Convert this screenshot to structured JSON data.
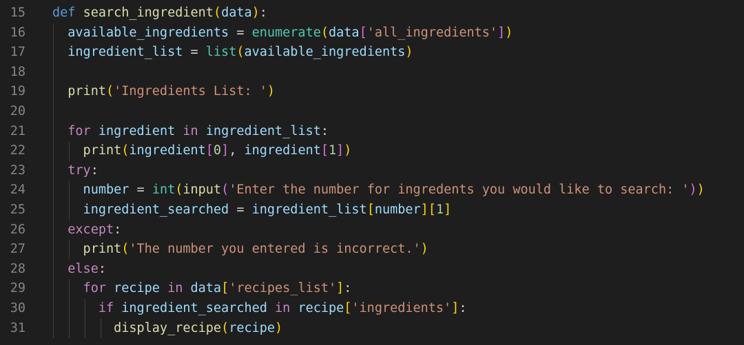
{
  "editor": {
    "lines": [
      {
        "number": "15",
        "indent_guides": 0,
        "tokens": [
          {
            "text": "def",
            "type": "keyword"
          },
          {
            "text": " ",
            "type": "plain"
          },
          {
            "text": "search_ingredient",
            "type": "function"
          },
          {
            "text": "(",
            "type": "bracket1"
          },
          {
            "text": "data",
            "type": "variable"
          },
          {
            "text": ")",
            "type": "bracket1"
          },
          {
            "text": ":",
            "type": "punct"
          }
        ]
      },
      {
        "number": "16",
        "indent_guides": 1,
        "tokens": [
          {
            "text": "  available_ingredients",
            "type": "variable"
          },
          {
            "text": " = ",
            "type": "operator"
          },
          {
            "text": "enumerate",
            "type": "builtin"
          },
          {
            "text": "(",
            "type": "bracket1"
          },
          {
            "text": "data",
            "type": "variable"
          },
          {
            "text": "[",
            "type": "bracket2"
          },
          {
            "text": "'all_ingredients'",
            "type": "string"
          },
          {
            "text": "]",
            "type": "bracket2"
          },
          {
            "text": ")",
            "type": "bracket1"
          }
        ]
      },
      {
        "number": "17",
        "indent_guides": 1,
        "tokens": [
          {
            "text": "  ingredient_list",
            "type": "variable"
          },
          {
            "text": " = ",
            "type": "operator"
          },
          {
            "text": "list",
            "type": "builtin"
          },
          {
            "text": "(",
            "type": "bracket1"
          },
          {
            "text": "available_ingredients",
            "type": "variable"
          },
          {
            "text": ")",
            "type": "bracket1"
          }
        ]
      },
      {
        "number": "18",
        "indent_guides": 1,
        "tokens": []
      },
      {
        "number": "19",
        "indent_guides": 1,
        "tokens": [
          {
            "text": "  print",
            "type": "function"
          },
          {
            "text": "(",
            "type": "bracket1"
          },
          {
            "text": "'Ingredients List: '",
            "type": "string"
          },
          {
            "text": ")",
            "type": "bracket1"
          }
        ]
      },
      {
        "number": "20",
        "indent_guides": 1,
        "tokens": []
      },
      {
        "number": "21",
        "indent_guides": 1,
        "tokens": [
          {
            "text": "  for",
            "type": "control"
          },
          {
            "text": " ",
            "type": "plain"
          },
          {
            "text": "ingredient",
            "type": "variable"
          },
          {
            "text": " ",
            "type": "plain"
          },
          {
            "text": "in",
            "type": "control"
          },
          {
            "text": " ",
            "type": "plain"
          },
          {
            "text": "ingredient_list",
            "type": "variable"
          },
          {
            "text": ":",
            "type": "punct"
          }
        ]
      },
      {
        "number": "22",
        "indent_guides": 2,
        "tokens": [
          {
            "text": "    print",
            "type": "function"
          },
          {
            "text": "(",
            "type": "bracket1"
          },
          {
            "text": "ingredient",
            "type": "variable"
          },
          {
            "text": "[",
            "type": "bracket2"
          },
          {
            "text": "0",
            "type": "number"
          },
          {
            "text": "]",
            "type": "bracket2"
          },
          {
            "text": ", ",
            "type": "punct"
          },
          {
            "text": "ingredient",
            "type": "variable"
          },
          {
            "text": "[",
            "type": "bracket2"
          },
          {
            "text": "1",
            "type": "number"
          },
          {
            "text": "]",
            "type": "bracket2"
          },
          {
            "text": ")",
            "type": "bracket1"
          }
        ]
      },
      {
        "number": "23",
        "indent_guides": 1,
        "tokens": [
          {
            "text": "  try",
            "type": "control"
          },
          {
            "text": ":",
            "type": "punct"
          }
        ]
      },
      {
        "number": "24",
        "indent_guides": 2,
        "tokens": [
          {
            "text": "    number",
            "type": "variable"
          },
          {
            "text": " = ",
            "type": "operator"
          },
          {
            "text": "int",
            "type": "builtin"
          },
          {
            "text": "(",
            "type": "bracket1"
          },
          {
            "text": "input",
            "type": "function"
          },
          {
            "text": "(",
            "type": "bracket2"
          },
          {
            "text": "'Enter the number for ingredents you would like to search: '",
            "type": "string"
          },
          {
            "text": ")",
            "type": "bracket2"
          },
          {
            "text": ")",
            "type": "bracket1"
          }
        ]
      },
      {
        "number": "25",
        "indent_guides": 2,
        "tokens": [
          {
            "text": "    ingredient_searched",
            "type": "variable"
          },
          {
            "text": " = ",
            "type": "operator"
          },
          {
            "text": "ingredient_list",
            "type": "variable"
          },
          {
            "text": "[",
            "type": "bracket1"
          },
          {
            "text": "number",
            "type": "variable"
          },
          {
            "text": "]",
            "type": "bracket1"
          },
          {
            "text": "[",
            "type": "bracket1"
          },
          {
            "text": "1",
            "type": "number"
          },
          {
            "text": "]",
            "type": "bracket1"
          }
        ]
      },
      {
        "number": "26",
        "indent_guides": 1,
        "tokens": [
          {
            "text": "  except",
            "type": "control"
          },
          {
            "text": ":",
            "type": "punct"
          }
        ]
      },
      {
        "number": "27",
        "indent_guides": 2,
        "tokens": [
          {
            "text": "    print",
            "type": "function"
          },
          {
            "text": "(",
            "type": "bracket1"
          },
          {
            "text": "'The number you entered is incorrect.'",
            "type": "string"
          },
          {
            "text": ")",
            "type": "bracket1"
          }
        ]
      },
      {
        "number": "28",
        "indent_guides": 1,
        "tokens": [
          {
            "text": "  else",
            "type": "control"
          },
          {
            "text": ":",
            "type": "punct"
          }
        ]
      },
      {
        "number": "29",
        "indent_guides": 2,
        "tokens": [
          {
            "text": "    for",
            "type": "control"
          },
          {
            "text": " ",
            "type": "plain"
          },
          {
            "text": "recipe",
            "type": "variable"
          },
          {
            "text": " ",
            "type": "plain"
          },
          {
            "text": "in",
            "type": "control"
          },
          {
            "text": " ",
            "type": "plain"
          },
          {
            "text": "data",
            "type": "variable"
          },
          {
            "text": "[",
            "type": "bracket1"
          },
          {
            "text": "'recipes_list'",
            "type": "string"
          },
          {
            "text": "]",
            "type": "bracket1"
          },
          {
            "text": ":",
            "type": "punct"
          }
        ]
      },
      {
        "number": "30",
        "indent_guides": 3,
        "tokens": [
          {
            "text": "      if",
            "type": "control"
          },
          {
            "text": " ",
            "type": "plain"
          },
          {
            "text": "ingredient_searched",
            "type": "variable"
          },
          {
            "text": " ",
            "type": "plain"
          },
          {
            "text": "in",
            "type": "control"
          },
          {
            "text": " ",
            "type": "plain"
          },
          {
            "text": "recipe",
            "type": "variable"
          },
          {
            "text": "[",
            "type": "bracket1"
          },
          {
            "text": "'ingredients'",
            "type": "string"
          },
          {
            "text": "]",
            "type": "bracket1"
          },
          {
            "text": ":",
            "type": "punct"
          }
        ]
      },
      {
        "number": "31",
        "indent_guides": 4,
        "tokens": [
          {
            "text": "        display_recipe",
            "type": "function"
          },
          {
            "text": "(",
            "type": "bracket1"
          },
          {
            "text": "recipe",
            "type": "variable"
          },
          {
            "text": ")",
            "type": "bracket1"
          }
        ]
      }
    ]
  }
}
